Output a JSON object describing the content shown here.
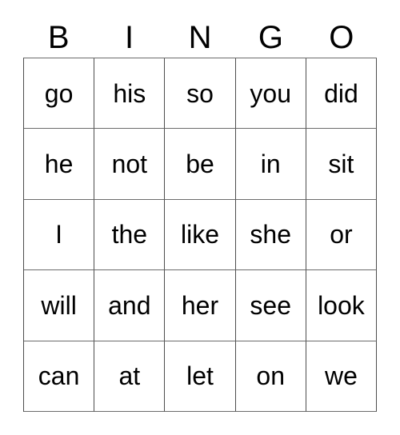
{
  "card": {
    "headers": [
      "B",
      "I",
      "N",
      "G",
      "O"
    ],
    "rows": [
      [
        "go",
        "his",
        "so",
        "you",
        "did"
      ],
      [
        "he",
        "not",
        "be",
        "in",
        "sit"
      ],
      [
        "I",
        "the",
        "like",
        "she",
        "or"
      ],
      [
        "will",
        "and",
        "her",
        "see",
        "look"
      ],
      [
        "can",
        "at",
        "let",
        "on",
        "we"
      ]
    ],
    "colors": {
      "text": "#000000",
      "background": "#ffffff",
      "grid_line": "#4d4d4d"
    }
  }
}
